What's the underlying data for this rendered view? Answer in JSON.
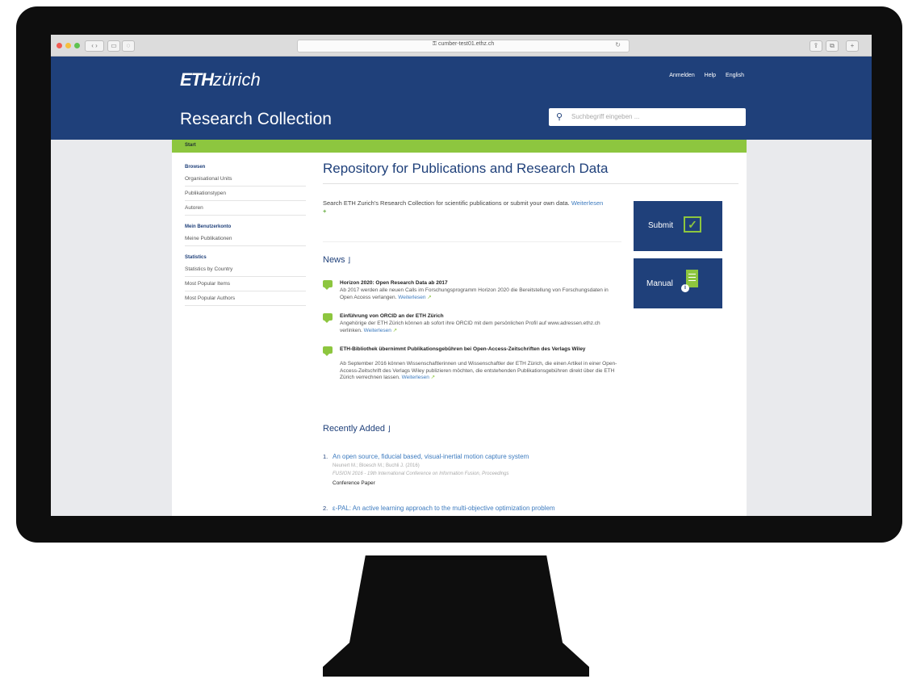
{
  "browser": {
    "url": "",
    "url_display": "⚿ cumber-test01.ethz.ch",
    "reload": "↻"
  },
  "header": {
    "logo_bold": "ETH",
    "logo_rest": "zürich",
    "links": [
      "Anmelden",
      "Help",
      "English"
    ],
    "site_title": "Research Collection",
    "search_placeholder": "Suchbegriff eingeben ..."
  },
  "breadcrumb": "Start",
  "sidebar": {
    "sections": [
      {
        "heading": "Browsen",
        "items": [
          "Organisational Units",
          "Publikationstypen",
          "Autoren"
        ]
      },
      {
        "heading": "Mein Benutzerkonto",
        "items": [
          "Meine Publikationen"
        ]
      },
      {
        "heading": "Statistics",
        "items": [
          "Statistics by Country",
          "Most Popular Items",
          "Most Popular Authors"
        ]
      }
    ]
  },
  "main": {
    "title": "Repository for Publications and Research Data",
    "intro": "Search ETH Zurich's Research Collection for scientific publications or submit your own data.",
    "more": "Weiterlesen",
    "tiles": {
      "submit": "Submit",
      "manual": "Manual"
    },
    "news_heading": "News",
    "news": [
      {
        "title": "Horizon 2020: Open Research Data ab 2017",
        "text": "Ab 2017 werden alle neuen Calls im Forschungsprogramm Horizon 2020 die Bereitstellung von Forschungsdaten in Open Access verlangen.",
        "more": "Weiterlesen"
      },
      {
        "title": "Einführung von ORCID an der ETH Zürich",
        "text": "Angehörige der ETH Zürich können ab sofort ihre ORCID mit dem persönlichen Profil auf www.adressen.ethz.ch verlinken.",
        "more": "Weiterlesen"
      },
      {
        "title": "ETH-Bibliothek übernimmt Publikationsgebühren bei Open-Access-Zeitschriften des Verlags Wiley",
        "text": "Ab September 2016 können Wissenschaftlerinnen und Wissenschaftler der ETH Zürich, die einen Artikel in einer Open-Access-Zeitschrift des Verlags Wiley publizieren möchten, die entstehenden Publikationsgebühren direkt über die ETH Zürich verrechnen lassen.",
        "more": "Weiterlesen"
      }
    ],
    "recent_heading": "Recently Added",
    "recent": [
      {
        "num": "1.",
        "title": "An open source, fiducial based, visual-inertial motion capture system",
        "authors": "Neunert M.; Bloesch M.; Buchli J. (2016)",
        "venue": "FUSION 2016 - 19th International Conference on Information Fusion, Proceedings",
        "type": "Conference Paper"
      },
      {
        "num": "2.",
        "title": "ε-PAL: An active learning approach to the multi-objective optimization problem",
        "authors": "",
        "venue": "",
        "type": ""
      }
    ]
  }
}
